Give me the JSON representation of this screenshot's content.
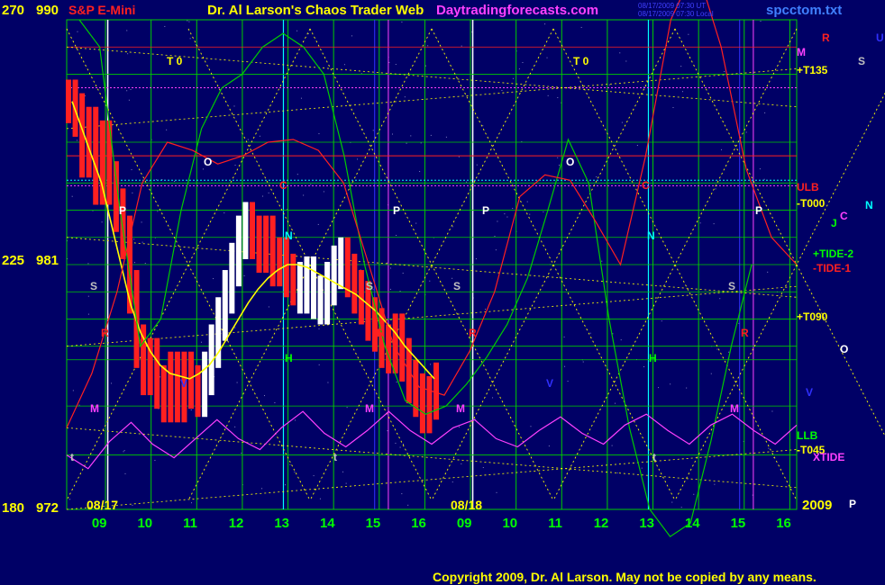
{
  "header": {
    "left_price_top": "270",
    "left_price_top_label": "990",
    "instrument": "S&P E-Mini",
    "title": "Dr. Al Larson's Chaos Trader Web",
    "site": "Daytradingforecasts.com",
    "stamp_line1": "08/17/2009 07:30 UT",
    "stamp_line2": "08/17/2009 07:30 Local",
    "file": "spcctom.txt"
  },
  "left_axis": {
    "mid_a": "225",
    "mid_b": "981",
    "bot_a": "180",
    "bot_b": "972"
  },
  "date_labels": [
    "08/17",
    "08/18"
  ],
  "year_label": "2009",
  "copyright": "Copyright 2009, Dr. Al Larson. May not be copied by any means.",
  "colors": {
    "background": "#000066",
    "grid_green": "#00cc00",
    "grid_white": "#ffffff",
    "yellow": "#ffff00",
    "red": "#ff2020",
    "magenta": "#ff40ff",
    "cyan": "#00ffff",
    "blue": "#3030ff"
  },
  "right_labels": [
    {
      "text": "R",
      "color": "#ff2020"
    },
    {
      "text": "U",
      "color": "#3030ff"
    },
    {
      "text": "M",
      "color": "#ff40ff"
    },
    {
      "text": "S",
      "color": "#c0c0c0"
    },
    {
      "text": "+T135",
      "color": "#ffff00"
    },
    {
      "text": "ULB",
      "color": "#ff2020"
    },
    {
      "text": "-T000",
      "color": "#ffff00"
    },
    {
      "text": "C",
      "color": "#ff40ff"
    },
    {
      "text": "N",
      "color": "#00ffff"
    },
    {
      "text": "J",
      "color": "#00ff00"
    },
    {
      "text": "+TIDE-2",
      "color": "#00ff00"
    },
    {
      "text": "-TIDE-1",
      "color": "#ff2020"
    },
    {
      "text": "+T090",
      "color": "#ffff00"
    },
    {
      "text": "O",
      "color": "#ffffff"
    },
    {
      "text": "V",
      "color": "#3030ff"
    },
    {
      "text": "LLB",
      "color": "#00ff00"
    },
    {
      "text": "-T045",
      "color": "#ffff00"
    },
    {
      "text": "XTIDE",
      "color": "#ff40ff"
    },
    {
      "text": "P",
      "color": "#ffffff"
    }
  ],
  "in_chart_markers": [
    {
      "text": "T 0",
      "color": "#ffff00"
    },
    {
      "text": "T 0",
      "color": "#ffff00"
    },
    {
      "text": "O",
      "color": "#ffffff"
    },
    {
      "text": "O",
      "color": "#ffffff"
    },
    {
      "text": "P",
      "color": "#ffffff"
    },
    {
      "text": "P",
      "color": "#ffffff"
    },
    {
      "text": "P",
      "color": "#ffffff"
    },
    {
      "text": "P",
      "color": "#ffffff"
    },
    {
      "text": "N",
      "color": "#00ffff"
    },
    {
      "text": "N",
      "color": "#00ffff"
    },
    {
      "text": "S",
      "color": "#c0c0c0"
    },
    {
      "text": "S",
      "color": "#c0c0c0"
    },
    {
      "text": "S",
      "color": "#c0c0c0"
    },
    {
      "text": "S",
      "color": "#c0c0c0"
    },
    {
      "text": "R",
      "color": "#ff2020"
    },
    {
      "text": "R",
      "color": "#ff2020"
    },
    {
      "text": "R",
      "color": "#ff2020"
    },
    {
      "text": "R",
      "color": "#ff2020"
    },
    {
      "text": "M",
      "color": "#ff40ff"
    },
    {
      "text": "M",
      "color": "#ff40ff"
    },
    {
      "text": "M",
      "color": "#ff40ff"
    },
    {
      "text": "M",
      "color": "#ff40ff"
    },
    {
      "text": "t",
      "color": "#c0c0c0"
    },
    {
      "text": "t",
      "color": "#c0c0c0"
    },
    {
      "text": "t",
      "color": "#c0c0c0"
    },
    {
      "text": "C",
      "color": "#ff2020"
    },
    {
      "text": "C",
      "color": "#ff2020"
    },
    {
      "text": "H",
      "color": "#00ff00"
    },
    {
      "text": "H",
      "color": "#00ff00"
    },
    {
      "text": "V",
      "color": "#3030ff"
    },
    {
      "text": "V",
      "color": "#3030ff"
    }
  ],
  "chart_data": {
    "type": "line",
    "x_tick_labels": [
      "09",
      "10",
      "11",
      "12",
      "13",
      "14",
      "15",
      "16",
      "09",
      "10",
      "11",
      "12",
      "13",
      "14",
      "15",
      "16"
    ],
    "left_scale": {
      "top": 990,
      "mid": 981,
      "bottom": 972
    },
    "secondary_scale": {
      "top": 270,
      "mid": 225,
      "bottom": 180
    },
    "grid": true,
    "series": [
      {
        "name": "",
        "kind": "price_bars",
        "color": "#ff2020",
        "values": [
          987,
          986.5,
          985,
          986,
          984,
          985.5,
          984,
          983,
          982,
          980,
          978,
          977,
          977.5,
          976.5,
          976,
          977,
          976,
          977,
          976.5,
          976.2,
          977,
          978,
          979,
          980,
          981,
          982,
          982.5,
          982,
          981.5,
          982,
          981,
          981.2,
          980.6,
          980.3,
          980,
          980.5,
          979.8,
          979.6,
          980.3,
          980.9,
          981.2,
          980.6,
          980,
          979.6,
          979,
          978.6,
          978,
          977.8,
          978.4,
          977.5,
          976.7,
          976.2,
          975.6,
          976.1,
          976.6
        ]
      },
      {
        "name": "",
        "kind": "moving_average",
        "color": "#ffff00",
        "values": [
          987,
          986,
          985,
          984,
          982.5,
          981,
          979.5,
          978.5,
          977.8,
          977.3,
          977,
          976.9,
          976.8,
          977,
          977.3,
          977.8,
          978.4,
          979,
          979.6,
          980.1,
          980.5,
          980.8,
          981,
          981,
          980.9,
          980.7,
          980.5,
          980.3,
          980.1,
          979.9,
          979.6,
          979.3,
          978.9,
          978.5,
          978,
          977.6,
          977.2,
          976.8
        ]
      },
      {
        "name": "+TIDE-2",
        "kind": "wave",
        "color": "#00cc00",
        "values": [
          990,
          989,
          983,
          978,
          979,
          983,
          986,
          987.5,
          988,
          989,
          989.5,
          989,
          988,
          985,
          981,
          978,
          976,
          975.5,
          975.8,
          976.6,
          977.6,
          978.8,
          980.5,
          983,
          985.6,
          984,
          979,
          975,
          972,
          971,
          971.5,
          974.5,
          978,
          981
        ]
      },
      {
        "name": "-TIDE-1",
        "kind": "wave",
        "color": "#ff2020",
        "values": [
          975,
          977,
          980,
          984,
          985.5,
          985.2,
          984.7,
          985,
          985.5,
          985.6,
          985.2,
          984,
          981,
          978,
          976.5,
          976.2,
          977.8,
          980,
          983.5,
          984.3,
          984.1,
          982.6,
          981,
          985,
          990,
          992,
          989,
          984.5,
          982,
          981
        ]
      },
      {
        "name": "XTIDE",
        "kind": "cycles",
        "color": "#ff40ff",
        "values": [
          974,
          973.5,
          974.5,
          975.2,
          974.4,
          973.9,
          974.6,
          975.3,
          974.6,
          974.2,
          975,
          975.6,
          974.8,
          974.3,
          974.9,
          975.6,
          974.9,
          974.4,
          975,
          975.3,
          974.6,
          974.3,
          974.9,
          975.4,
          974.8,
          974.4,
          975.1,
          975.5,
          974.9,
          974.4,
          975.1,
          975.5,
          974.9,
          974.4,
          975.1
        ]
      }
    ],
    "xlabel": "",
    "ylabel": ""
  }
}
